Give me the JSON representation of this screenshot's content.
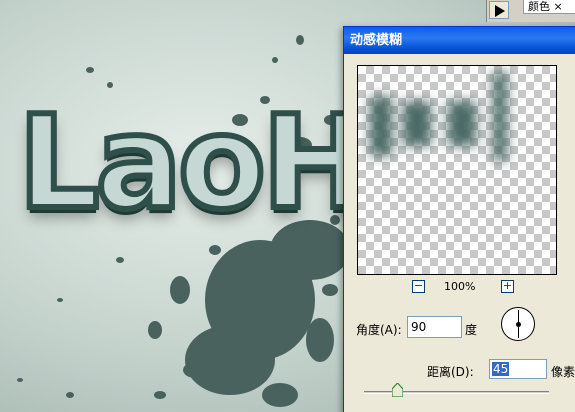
{
  "canvas": {
    "logo_text": "LaoH"
  },
  "panel": {
    "tab_label": "颜色 ×",
    "play_icon": "play-triangle-icon"
  },
  "dialog": {
    "title": "动感模糊",
    "zoom": {
      "minus_label": "−",
      "level": "100%",
      "plus_label": "+"
    },
    "angle": {
      "label": "角度(A):",
      "value": "90",
      "unit": "度"
    },
    "distance": {
      "label": "距离(D):",
      "value": "45",
      "unit": "像素"
    },
    "distance_slider_fraction": 0.18
  },
  "colors": {
    "title_bar": "#0a5ee8",
    "dialog_bg": "#ece9d8",
    "selection": "#316ac5",
    "splatter": "#4a625e"
  }
}
